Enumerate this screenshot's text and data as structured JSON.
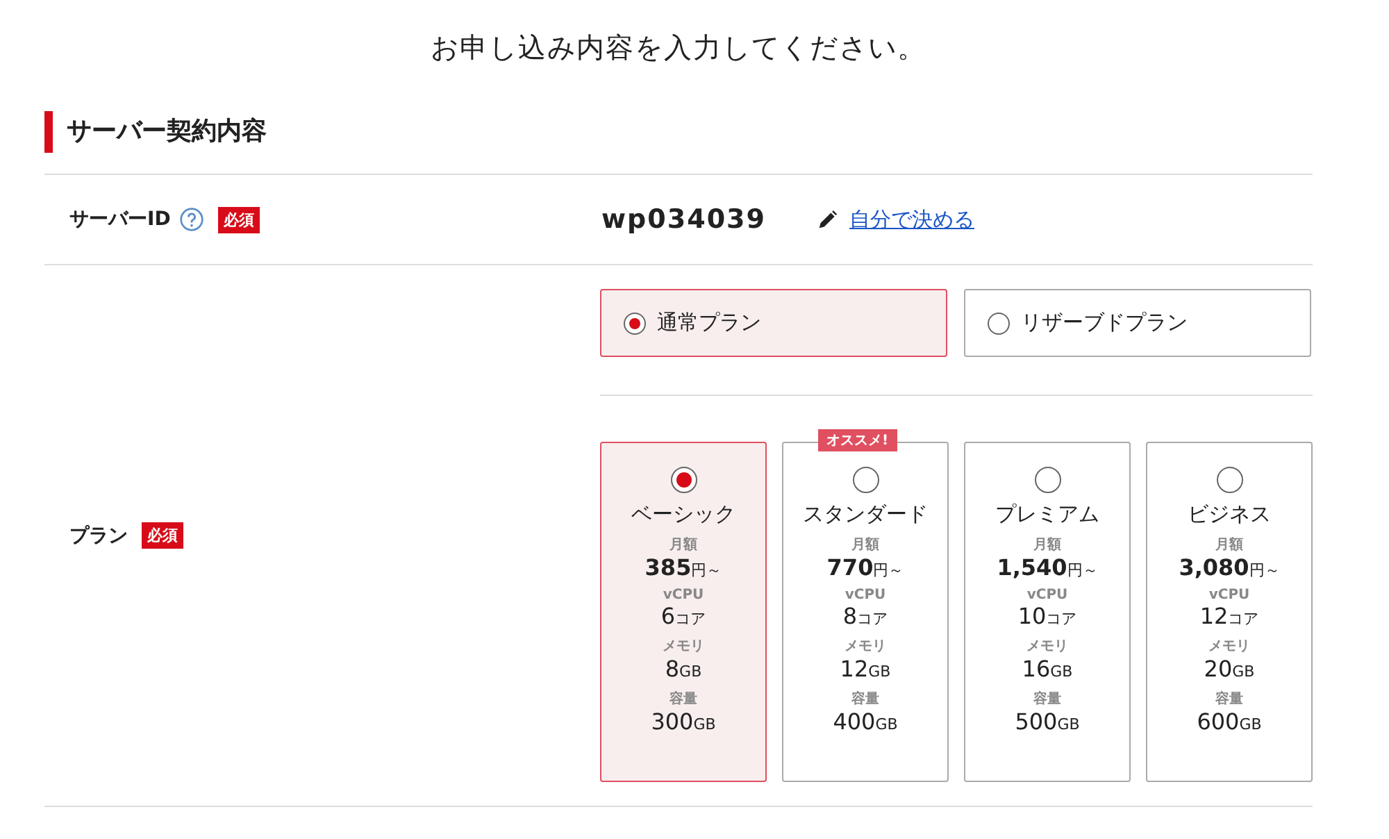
{
  "page_title": "お申し込み内容を入力してください。",
  "section_heading": "サーバー契約内容",
  "server_id": {
    "label": "サーバーID",
    "required_badge": "必須",
    "value": "wp034039",
    "link": "自分で決める"
  },
  "plan": {
    "label": "プラン",
    "required_badge": "必須",
    "plan_types": [
      {
        "label": "通常プラン",
        "selected": true
      },
      {
        "label": "リザーブドプラン",
        "selected": false
      }
    ],
    "plans": [
      {
        "name": "ベーシック",
        "selected": true,
        "specs": [
          {
            "label": "月額",
            "value": "385",
            "unit": "円～",
            "kind": "price"
          },
          {
            "label": "vCPU",
            "value": "6",
            "unit": "コア",
            "kind": "spec"
          },
          {
            "label": "メモリ",
            "value": "8",
            "unit": "GB",
            "kind": "spec"
          },
          {
            "label": "容量",
            "value": "300",
            "unit": "GB",
            "kind": "spec"
          }
        ]
      },
      {
        "name": "スタンダード",
        "selected": false,
        "badge": "オススメ!",
        "specs": [
          {
            "label": "月額",
            "value": "770",
            "unit": "円～",
            "kind": "price"
          },
          {
            "label": "vCPU",
            "value": "8",
            "unit": "コア",
            "kind": "spec"
          },
          {
            "label": "メモリ",
            "value": "12",
            "unit": "GB",
            "kind": "spec"
          },
          {
            "label": "容量",
            "value": "400",
            "unit": "GB",
            "kind": "spec"
          }
        ]
      },
      {
        "name": "プレミアム",
        "selected": false,
        "specs": [
          {
            "label": "月額",
            "value": "1,540",
            "unit": "円～",
            "kind": "price"
          },
          {
            "label": "vCPU",
            "value": "10",
            "unit": "コア",
            "kind": "spec"
          },
          {
            "label": "メモリ",
            "value": "16",
            "unit": "GB",
            "kind": "spec"
          },
          {
            "label": "容量",
            "value": "500",
            "unit": "GB",
            "kind": "spec"
          }
        ]
      },
      {
        "name": "ビジネス",
        "selected": false,
        "specs": [
          {
            "label": "月額",
            "value": "3,080",
            "unit": "円～",
            "kind": "price"
          },
          {
            "label": "vCPU",
            "value": "12",
            "unit": "コア",
            "kind": "spec"
          },
          {
            "label": "メモリ",
            "value": "20",
            "unit": "GB",
            "kind": "spec"
          },
          {
            "label": "容量",
            "value": "600",
            "unit": "GB",
            "kind": "spec"
          }
        ]
      }
    ]
  }
}
